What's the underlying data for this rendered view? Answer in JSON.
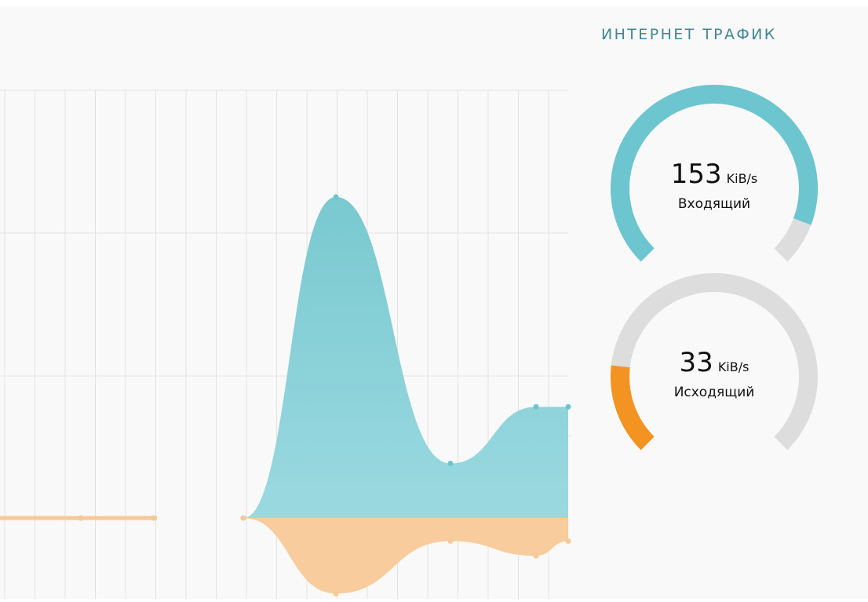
{
  "widget": {
    "title": "ИНТЕРНЕТ ТРАФИК"
  },
  "gauges": {
    "incoming": {
      "value": "153",
      "unit": "KiB/s",
      "label": "Входящий",
      "fill_fraction": 0.91,
      "color": "#6cc5cf",
      "track_color": "#dddddd"
    },
    "outgoing": {
      "value": "33",
      "unit": "KiB/s",
      "label": "Исходящий",
      "fill_fraction": 0.19,
      "color": "#f39322",
      "track_color": "#dddddd"
    }
  },
  "chart_data": {
    "type": "area",
    "x": [
      0,
      1,
      2,
      3,
      4,
      5,
      6,
      7
    ],
    "series": [
      {
        "values": [
          0,
          0,
          0,
          0,
          153,
          26,
          53,
          53
        ],
        "color": "#6cc5cf"
      },
      {
        "values": [
          0,
          0,
          0,
          0,
          -36,
          -11,
          -18,
          -11
        ],
        "color": "#f8c896"
      }
    ],
    "ylim": [
      -38,
      207
    ],
    "grid": true,
    "colors": {
      "grid": "#e2e2e2",
      "incoming_fill_top": "#79c9d0",
      "incoming_fill_bottom": "#9bd9e0",
      "outgoing_fill": "#f8cc9c"
    }
  }
}
